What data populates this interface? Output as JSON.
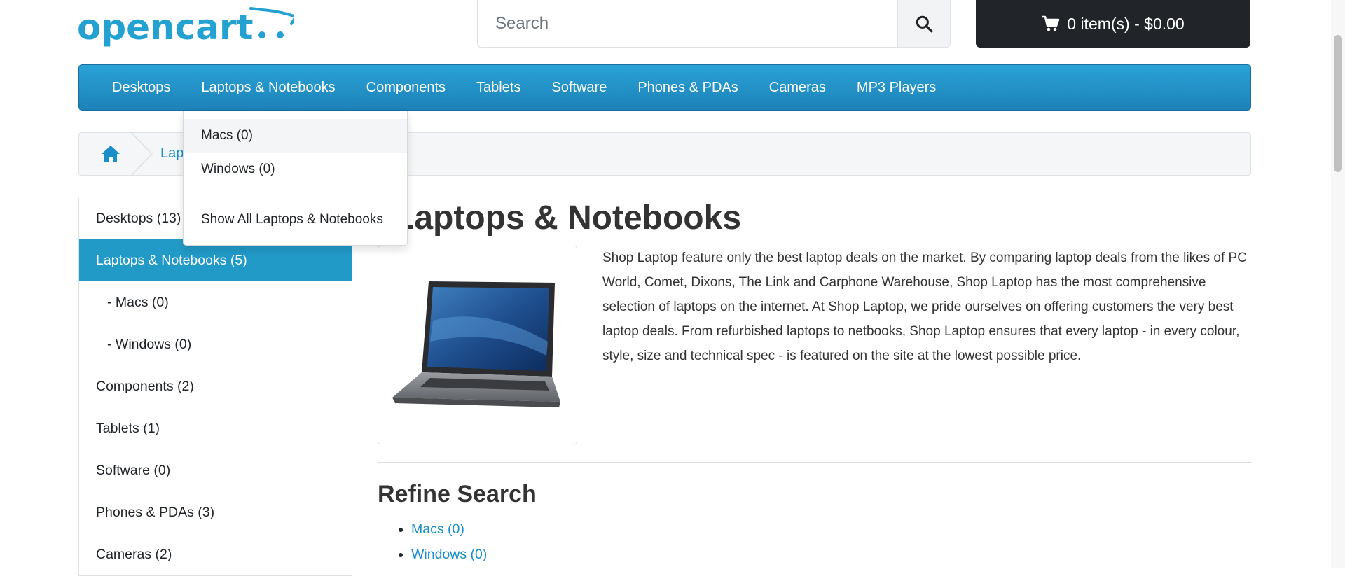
{
  "brand": {
    "name": "opencart",
    "color": "#23a1d1"
  },
  "search": {
    "placeholder": "Search",
    "value": "",
    "icon": "search-icon"
  },
  "cart": {
    "label": "0 item(s) - $0.00",
    "icon": "cart-icon"
  },
  "menu": {
    "items": [
      "Desktops",
      "Laptops & Notebooks",
      "Components",
      "Tablets",
      "Software",
      "Phones & PDAs",
      "Cameras",
      "MP3 Players"
    ]
  },
  "dropdown": {
    "items": [
      "Macs (0)",
      "Windows (0)"
    ],
    "show_all": "Show All Laptops & Notebooks"
  },
  "breadcrumb": {
    "home_icon": "home-icon",
    "current": "Lapt"
  },
  "sidebar": {
    "items": [
      {
        "label": "Desktops (13)"
      },
      {
        "label": "Laptops & Notebooks (5)"
      },
      {
        "label": "- Macs (0)"
      },
      {
        "label": "- Windows (0)"
      },
      {
        "label": "Components (2)"
      },
      {
        "label": "Tablets (1)"
      },
      {
        "label": "Software (0)"
      },
      {
        "label": "Phones & PDAs (3)"
      },
      {
        "label": "Cameras (2)"
      }
    ]
  },
  "main": {
    "title": "Laptops & Notebooks",
    "description": "Shop Laptop feature only the best laptop deals on the market. By comparing laptop deals from the likes of PC World, Comet, Dixons, The Link and Carphone Warehouse, Shop Laptop has the most comprehensive selection of laptops on the internet. At Shop Laptop, we pride ourselves on offering customers the very best laptop deals. From refurbished laptops to netbooks, Shop Laptop ensures that every laptop - in every colour, style, size and technical spec - is featured on the site at the lowest possible price.",
    "refine_title": "Refine Search",
    "refine_links": [
      "Macs (0)",
      "Windows (0)"
    ]
  },
  "colors": {
    "accent": "#229ac8",
    "link": "#1a8ec9",
    "cart_bg": "#212529"
  }
}
